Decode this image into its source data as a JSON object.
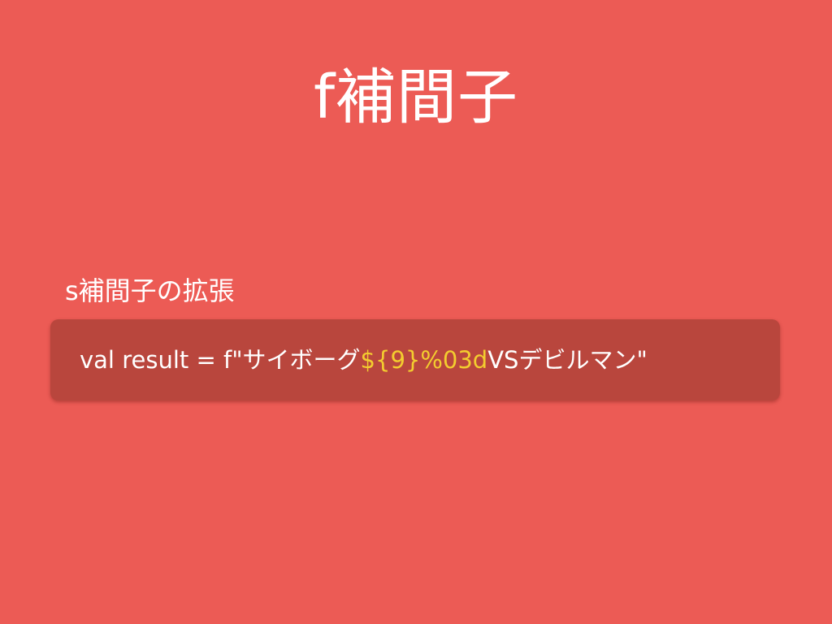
{
  "slide": {
    "title": "f補間子",
    "subtitle": "s補間子の拡張",
    "code": {
      "prefix": "val result = f\"サイボーグ",
      "highlight": "${9}%03d",
      "suffix": "VSデビルマン\""
    }
  },
  "colors": {
    "background": "#ec5b55",
    "code_background": "#b9463d",
    "text": "#ffffff",
    "highlight": "#f3cd2f"
  }
}
